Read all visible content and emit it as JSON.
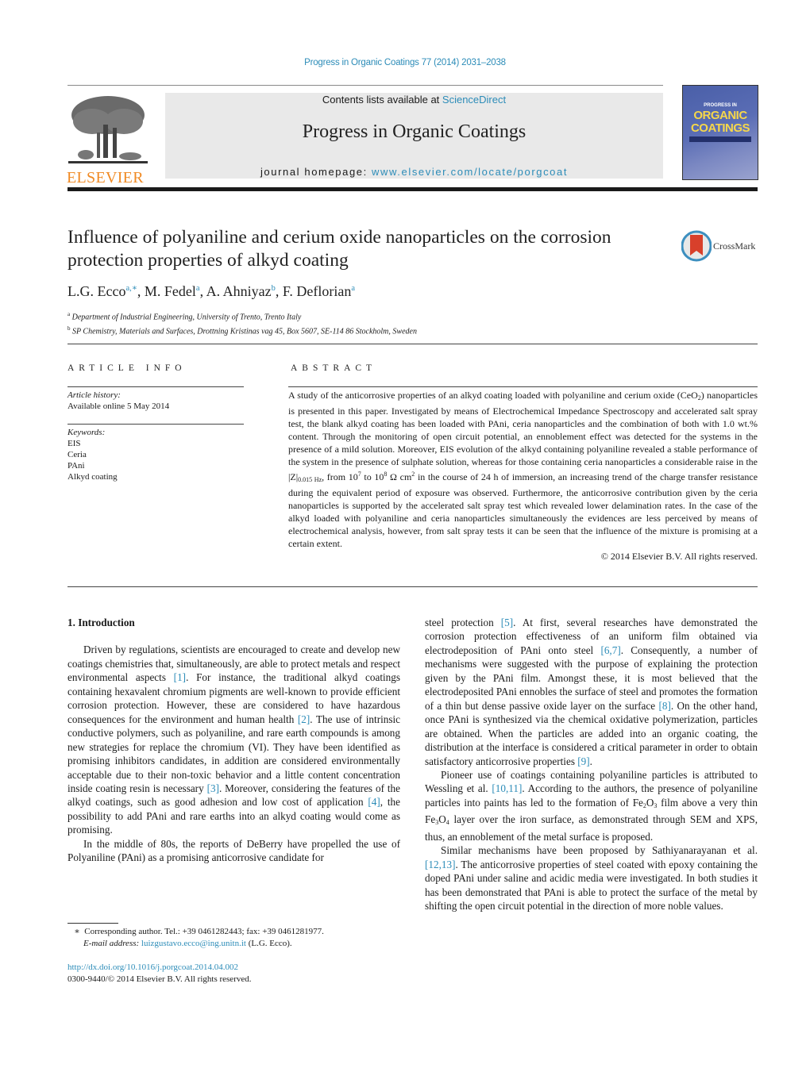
{
  "header": {
    "journal_ref": "Progress in Organic Coatings 77 (2014) 2031–2038",
    "contents_prefix": "Contents lists available at ",
    "contents_link": "ScienceDirect",
    "journal_title": "Progress in Organic Coatings",
    "homepage_prefix": "journal homepage: ",
    "homepage_link": "www.elsevier.com/locate/porgcoat",
    "publisher_logo_text": "ELSEVIER",
    "cover": {
      "top_text": "PROGRESS IN",
      "title_line1": "ORGANIC",
      "title_line2": "COATINGS"
    },
    "colors": {
      "link": "#2c8cb8",
      "elsevier_orange": "#f08a24",
      "header_box": "#e9e9e9"
    }
  },
  "article": {
    "title": "Influence of polyaniline and cerium oxide nanoparticles on the corrosion protection properties of alkyd coating",
    "crossmark_label": "CrossMark",
    "authors": [
      {
        "name": "L.G. Ecco",
        "sup": "a,∗"
      },
      {
        "name": "M. Fedel",
        "sup": "a"
      },
      {
        "name": "A. Ahniyaz",
        "sup": "b"
      },
      {
        "name": "F. Deflorian",
        "sup": "a"
      }
    ],
    "affiliations": [
      {
        "sup": "a",
        "text": "Department of Industrial Engineering, University of Trento, Trento Italy"
      },
      {
        "sup": "b",
        "text": "SP Chemistry, Materials and Surfaces, Drottning Kristinas vag 45, Box 5607, SE-114 86 Stockholm, Sweden"
      }
    ]
  },
  "article_info": {
    "heading": "ARTICLE INFO",
    "history_label": "Article history:",
    "history_value": "Available online 5 May 2014",
    "keywords_label": "Keywords:",
    "keywords": [
      "EIS",
      "Ceria",
      "PAni",
      "Alkyd coating"
    ]
  },
  "abstract": {
    "heading": "ABSTRACT",
    "part1": "A study of the anticorrosive properties of an alkyd coating loaded with polyaniline and cerium oxide (CeO",
    "part1_sub": "2",
    "part2": ") nanoparticles is presented in this paper. Investigated by means of Electrochemical Impedance Spectroscopy and accelerated salt spray test, the blank alkyd coating has been loaded with PAni, ceria nanoparticles and the combination of both with 1.0 wt.% content. Through the monitoring of open circuit potential, an ennoblement effect was detected for the systems in the presence of a mild solution. Moreover, EIS evolution of the alkyd containing polyaniline revealed a stable performance of the system in the presence of sulphate solution, whereas for those containing ceria nanoparticles a considerable raise in the |Z|",
    "part2_sub": "0.015 Hz",
    "part3": ", from 10",
    "exp1": "7",
    "part4": " to 10",
    "exp2": "8",
    "part5": " Ω cm",
    "exp3": "2",
    "part6": " in the course of 24 h of immersion, an increasing trend of the charge transfer resistance during the equivalent period of exposure was observed. Furthermore, the anticorrosive contribution given by the ceria nanoparticles is supported by the accelerated salt spray test which revealed lower delamination rates. In the case of the alkyd loaded with polyaniline and ceria nanoparticles simultaneously the evidences are less perceived by means of electrochemical analysis, however, from salt spray tests it can be seen that the influence of the mixture is promising at a certain extent.",
    "copyright": "© 2014 Elsevier B.V. All rights reserved."
  },
  "body": {
    "section_heading": "1.  Introduction",
    "left": {
      "p1": [
        "Driven by regulations, scientists are encouraged to create and develop new coatings chemistries that, simultaneously, are able to protect metals and respect environmental aspects ",
        "[1]",
        ". For instance, the traditional alkyd coatings containing hexavalent chromium pigments are well-known to provide efficient corrosion protection. However, these are considered to have hazardous consequences for the environment and human health ",
        "[2]",
        ". The use of intrinsic conductive polymers, such as polyaniline, and rare earth compounds is among new strategies for replace the chromium (VI). They have been identified as promising inhibitors candidates, in addition are considered environmentally acceptable due to their non-toxic behavior and a little content concentration inside coating resin is necessary ",
        "[3]",
        ". Moreover, considering the features of the alkyd coatings, such as good adhesion and low cost of application ",
        "[4]",
        ", the possibility to add PAni and rare earths into an alkyd coating would come as promising."
      ],
      "p2": "In the middle of 80s, the reports of DeBerry have propelled the use of Polyaniline (PAni) as a promising anticorrosive candidate for"
    },
    "right": {
      "p1": [
        "steel protection ",
        "[5]",
        ". At first, several researches have demonstrated the corrosion protection effectiveness of an uniform film obtained via electrodeposition of PAni onto steel ",
        "[6,7]",
        ". Consequently, a number of mechanisms were suggested with the purpose of explaining the protection given by the PAni film. Amongst these, it is most believed that the electrodeposited PAni ennobles the surface of steel and promotes the formation of a thin but dense passive oxide layer on the surface ",
        "[8]",
        ". On the other hand, once PAni is synthesized via the chemical oxidative polymerization, particles are obtained. When the particles are added into an organic coating, the distribution at the interface is considered a critical parameter in order to obtain satisfactory anticorrosive properties ",
        "[9]",
        "."
      ],
      "p2": [
        "Pioneer use of coatings containing polyaniline particles is attributed to Wessling et al. ",
        "[10,11]",
        ". According to the authors, the presence of polyaniline particles into paints has led to the formation of Fe",
        "2",
        "O",
        "3",
        " film above a very thin Fe",
        "3",
        "O",
        "4",
        " layer over the iron surface, as demonstrated through SEM and XPS, thus, an ennoblement of the metal surface is proposed."
      ],
      "p3": [
        "Similar mechanisms have been proposed by Sathiyanarayanan et al. ",
        "[12,13]",
        ". The anticorrosive properties of steel coated with epoxy containing the doped PAni under saline and acidic media were investigated. In both studies it has been demonstrated that PAni is able to protect the surface of the metal by shifting the open circuit potential in the direction of more noble values."
      ]
    }
  },
  "footnote": {
    "marker": "∗",
    "corresponding": "Corresponding author. Tel.: +39 0461282443; fax: +39 0461281977.",
    "email_label": "E-mail address:",
    "email": "luizgustavo.ecco@ing.unitn.it",
    "email_suffix": " (L.G. Ecco)."
  },
  "doi": {
    "link": "http://dx.doi.org/10.1016/j.porgcoat.2014.04.002",
    "issn_line": "0300-9440/© 2014 Elsevier B.V. All rights reserved."
  }
}
